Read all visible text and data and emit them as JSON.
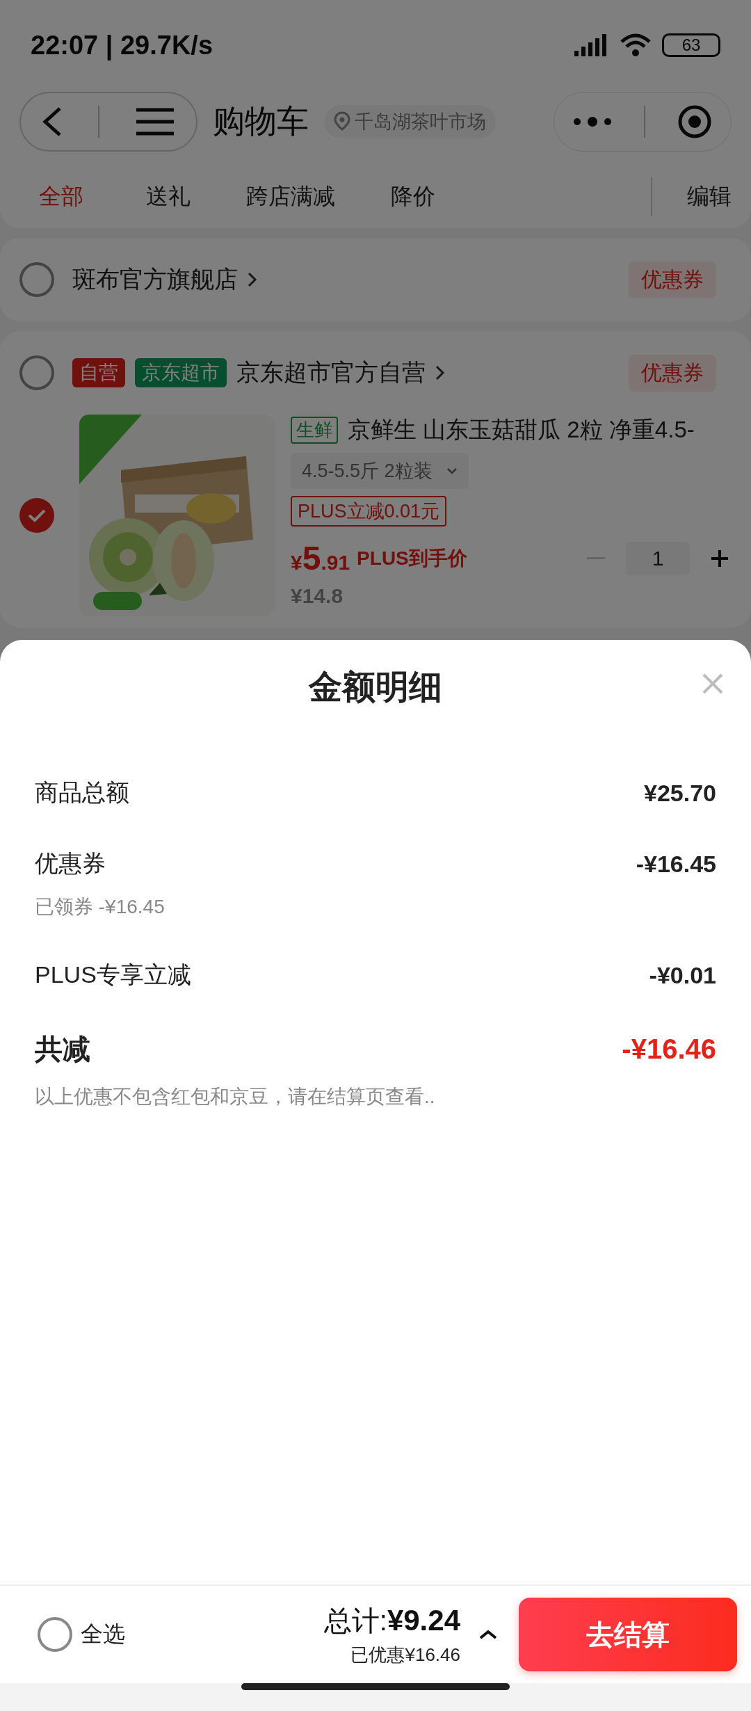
{
  "status_bar": {
    "time": "22:07 | 29.7K/s",
    "battery": "63"
  },
  "nav": {
    "title": "购物车",
    "location": "千岛湖茶叶市场"
  },
  "tabs": [
    {
      "label": "全部",
      "selected": true
    },
    {
      "label": "送礼",
      "selected": false
    },
    {
      "label": "跨店满减",
      "selected": false
    },
    {
      "label": "降价",
      "selected": false
    }
  ],
  "edit": "编辑",
  "stores": [
    {
      "name": "斑布官方旗舰店",
      "checked": false,
      "coupon": "优惠券"
    },
    {
      "name": "京东超市官方自营",
      "checked": false,
      "coupon": "优惠券",
      "badges": [
        {
          "label": "自营",
          "kind": "self"
        },
        {
          "label": "京东超市",
          "kind": "brand"
        }
      ],
      "items": [
        {
          "checked": true,
          "tag": "生鲜",
          "title": "京鲜生 山东玉菇甜瓜 2粒 净重4.5-",
          "spec": "4.5-5.5斤 2粒装",
          "promo": "PLUS立减0.01元",
          "currency": "¥",
          "price_int": "5",
          "price_dec": ".91",
          "price_note": "PLUS到手价",
          "original_price": "¥14.8",
          "quantity": "1"
        }
      ]
    }
  ],
  "sheet": {
    "title": "金额明细",
    "rows": [
      {
        "label": "商品总额",
        "value": "¥25.70"
      },
      {
        "label": "优惠券",
        "value": "-¥16.45",
        "note": "已领券 -¥16.45"
      },
      {
        "label": "PLUS专享立减",
        "value": "-¥0.01"
      }
    ],
    "total": {
      "label": "共减",
      "value": "-¥16.46"
    },
    "footnote": "以上优惠不包含红包和京豆，请在结算页查看.."
  },
  "bottom_bar": {
    "select_all": {
      "label": "全选",
      "checked": false
    },
    "total": "总计:**¥9.24**",
    "saved": "已优惠¥16.46",
    "checkout": "去结算"
  }
}
